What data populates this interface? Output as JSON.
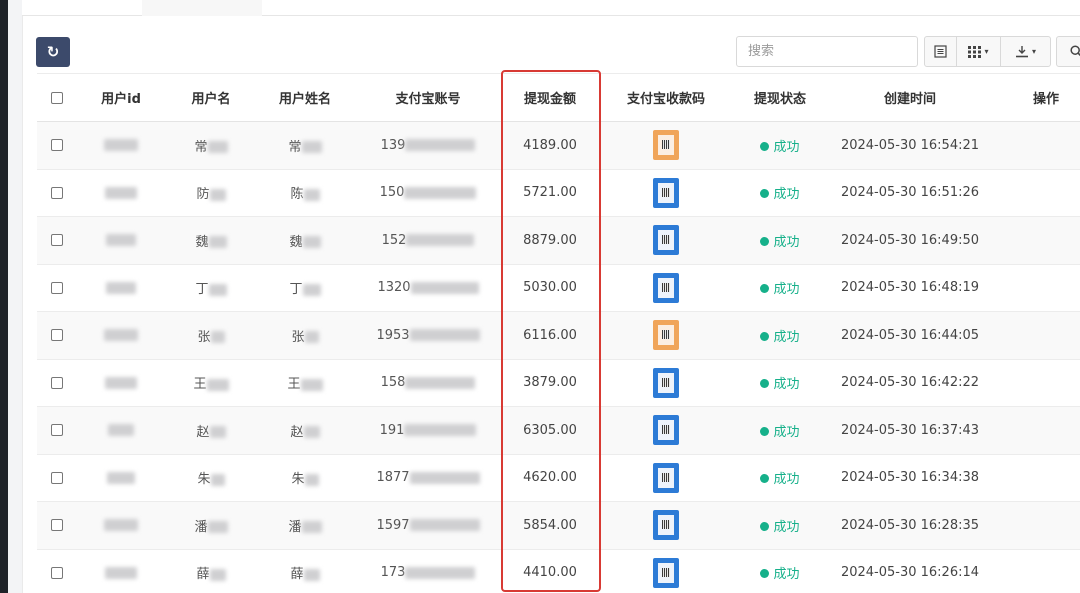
{
  "toolbar": {
    "refresh_icon": "refresh-icon",
    "search_placeholder": "搜索",
    "list_icon": "list-view-icon",
    "columns_icon": "columns-grid-icon",
    "export_icon": "export-icon",
    "search_icon": "search-icon",
    "dropdown_caret": "▾"
  },
  "table": {
    "headers": {
      "user_id": "用户id",
      "username": "用户名",
      "realname": "用户姓名",
      "alipay_account": "支付宝账号",
      "amount": "提现金额",
      "qr_code": "支付宝收款码",
      "status": "提现状态",
      "created": "创建时间",
      "actions": "操作"
    },
    "rows": [
      {
        "username": "常",
        "realname": "常",
        "account": "139",
        "amount": "4189.00",
        "qr": "orange",
        "status": "成功",
        "created": "2024-05-30 16:54:21"
      },
      {
        "username": "防",
        "realname": "陈",
        "account": "150",
        "amount": "5721.00",
        "qr": "blue",
        "status": "成功",
        "created": "2024-05-30 16:51:26"
      },
      {
        "username": "魏",
        "realname": "魏",
        "account": "152",
        "amount": "8879.00",
        "qr": "blue",
        "status": "成功",
        "created": "2024-05-30 16:49:50"
      },
      {
        "username": "丁",
        "realname": "丁",
        "account": "1320",
        "amount": "5030.00",
        "qr": "blue",
        "status": "成功",
        "created": "2024-05-30 16:48:19"
      },
      {
        "username": "张",
        "realname": "张",
        "account": "1953",
        "amount": "6116.00",
        "qr": "orange",
        "status": "成功",
        "created": "2024-05-30 16:44:05"
      },
      {
        "username": "王",
        "realname": "王",
        "account": "158",
        "amount": "3879.00",
        "qr": "blue",
        "status": "成功",
        "created": "2024-05-30 16:42:22"
      },
      {
        "username": "赵",
        "realname": "赵",
        "account": "191",
        "amount": "6305.00",
        "qr": "blue",
        "status": "成功",
        "created": "2024-05-30 16:37:43"
      },
      {
        "username": "朱",
        "realname": "朱",
        "account": "1877",
        "amount": "4620.00",
        "qr": "blue",
        "status": "成功",
        "created": "2024-05-30 16:34:38"
      },
      {
        "username": "潘",
        "realname": "潘",
        "account": "1597",
        "amount": "5854.00",
        "qr": "blue",
        "status": "成功",
        "created": "2024-05-30 16:28:35"
      },
      {
        "username": "薛",
        "realname": "薛",
        "account": "173",
        "amount": "4410.00",
        "qr": "blue",
        "status": "成功",
        "created": "2024-05-30 16:26:14"
      }
    ]
  },
  "colors": {
    "refresh_button": "#3c4a6b",
    "status_success": "#16b08a",
    "highlight_border": "#d83a34",
    "qr_blue": "#2d7bd6",
    "qr_orange": "#f0a55a"
  }
}
